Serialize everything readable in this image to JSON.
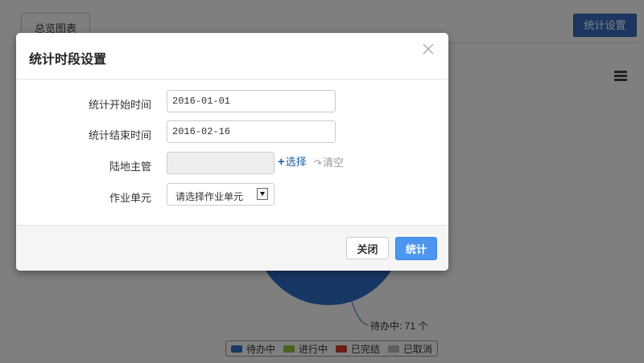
{
  "page": {
    "tab_label": "总览图表",
    "settings_button": "统计设置",
    "menu_icon": "hamburger-menu-icon"
  },
  "chart": {
    "slice_label": "待办中: 71 个",
    "legend": [
      {
        "label": "待办中",
        "color": "#2f6fc8"
      },
      {
        "label": "进行中",
        "color": "#8cc63e"
      },
      {
        "label": "已完结",
        "color": "#d23a2a"
      },
      {
        "label": "已取消",
        "color": "#bbbbbb"
      }
    ]
  },
  "chart_data": {
    "type": "pie",
    "series": [
      {
        "values": [
          71
        ]
      }
    ],
    "categories": [
      "待办中",
      "进行中",
      "已完结",
      "已取消"
    ],
    "legend_position": "bottom"
  },
  "modal": {
    "title": "统计时段设置",
    "close_icon": "close-icon",
    "fields": {
      "start_time": {
        "label": "统计开始时间",
        "value": "2016-01-01"
      },
      "end_time": {
        "label": "统计结束时间",
        "value": "2016-02-16"
      },
      "manager": {
        "label": "陆地主管",
        "value": "",
        "select_label": "选择",
        "clear_label": "清空"
      },
      "unit": {
        "label": "作业单元",
        "selected": "请选择作业单元"
      }
    },
    "buttons": {
      "close": "关闭",
      "submit": "统计"
    }
  },
  "colors": {
    "primary_button": "#3b6fc4",
    "submit_button": "#4d96ef",
    "link": "#1f5fa8",
    "pie_main": "#2f6fc8"
  }
}
